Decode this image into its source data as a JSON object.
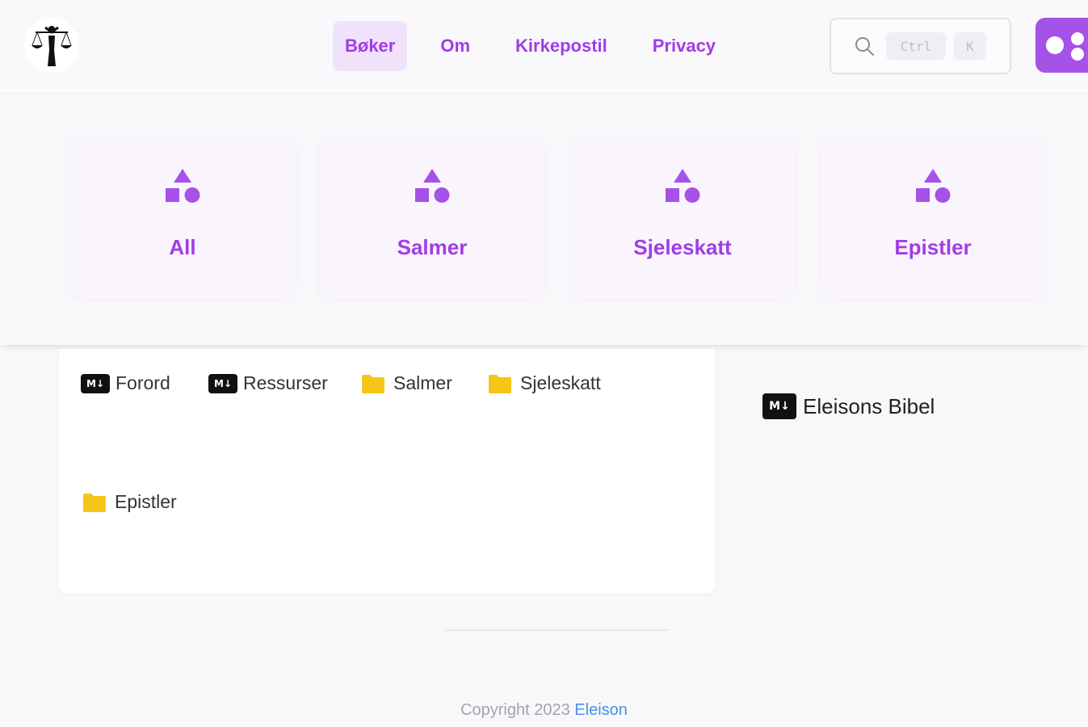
{
  "nav": {
    "links": [
      {
        "label": "Bøker",
        "active": true
      },
      {
        "label": "Om",
        "active": false
      },
      {
        "label": "Kirkepostil",
        "active": false
      },
      {
        "label": "Privacy",
        "active": false
      }
    ],
    "search": {
      "ctrl_key": "Ctrl",
      "k_key": "K",
      "icon": "search-icon"
    },
    "discord_icon": "discord-icon"
  },
  "categories": [
    {
      "label": "All",
      "icon": "shapes-icon"
    },
    {
      "label": "Salmer",
      "icon": "shapes-icon"
    },
    {
      "label": "Sjeleskatt",
      "icon": "shapes-icon"
    },
    {
      "label": "Epistler",
      "icon": "shapes-icon"
    }
  ],
  "files": [
    {
      "label": "Forord",
      "type": "markdown",
      "badge": "M↓"
    },
    {
      "label": "Ressurser",
      "type": "markdown",
      "badge": "M↓"
    },
    {
      "label": "Salmer",
      "type": "folder"
    },
    {
      "label": "Sjeleskatt",
      "type": "folder"
    },
    {
      "label": "Epistler",
      "type": "folder"
    }
  ],
  "sidebar": {
    "label": "Eleisons Bibel",
    "type": "markdown",
    "badge": "M↓"
  },
  "footer": {
    "text": "Copyright 2023",
    "link": "Eleison"
  },
  "colors": {
    "accent": "#a03de6",
    "accent_bg": "#f1e2fb",
    "card_bg": "#faf4fd",
    "folder": "#f5c518",
    "link": "#4a90e2"
  }
}
